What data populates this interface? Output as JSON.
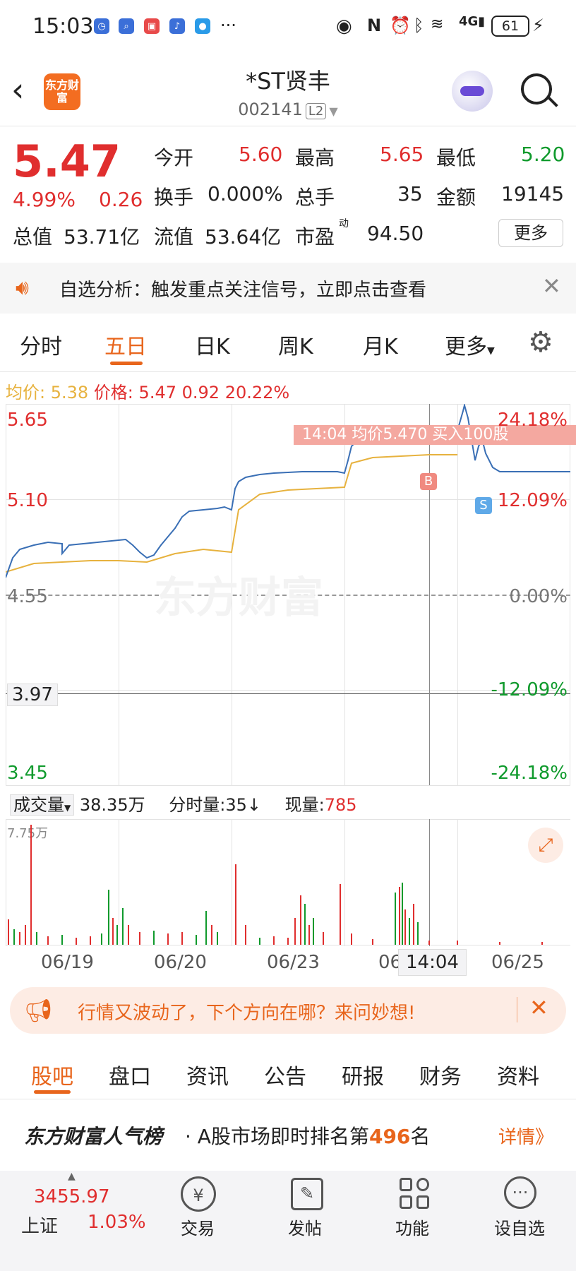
{
  "status_bar": {
    "time": "15:03",
    "more": "···",
    "battery": "61"
  },
  "header": {
    "title": "*ST贤丰",
    "code": "002141",
    "level_badge": "L2",
    "logo_text": "东方财富"
  },
  "quote": {
    "price": "5.47",
    "change_pct": "4.99%",
    "change": "0.26",
    "open_label": "今开",
    "open": "5.60",
    "high_label": "最高",
    "high": "5.65",
    "low_label": "最低",
    "low": "5.20",
    "turnover_label": "换手",
    "turnover": "0.000%",
    "volume_label": "总手",
    "volume": "35",
    "amount_label": "金额",
    "amount": "19145",
    "total_cap_label": "总值",
    "total_cap": "53.71亿",
    "float_cap_label": "流值",
    "float_cap": "53.64亿",
    "pe_label": "市盈",
    "pe_sup": "动",
    "pe": "94.50",
    "more_label": "更多"
  },
  "notify": {
    "text": "自选分析：触发重点关注信号，立即点击查看"
  },
  "tabs": [
    {
      "label": "分时",
      "active": false
    },
    {
      "label": "五日",
      "active": true
    },
    {
      "label": "日K",
      "active": false
    },
    {
      "label": "周K",
      "active": false
    },
    {
      "label": "月K",
      "active": false
    },
    {
      "label": "更多",
      "active": false
    }
  ],
  "info_line": {
    "avg_label": "均价:",
    "avg": "5.38",
    "price_label": "价格:",
    "price": "5.47",
    "change": "0.92",
    "change_pct": "20.22%"
  },
  "chart": {
    "y_left": [
      "5.65",
      "5.10",
      "4.55",
      "3.97",
      "3.45"
    ],
    "y_right": [
      "24.18%",
      "12.09%",
      "0.00%",
      "-12.09%",
      "-24.18%"
    ],
    "tooltip": "14:04  均价5.470  买入100股",
    "marker_buy": "B",
    "marker_sell": "S",
    "watermark": "东方财富",
    "vol_bar_label": "成交量",
    "vol_total": "38.35万",
    "vol_tick_label": "分时量:35↓",
    "vol_now_label": "现量:",
    "vol_now": "785",
    "vol_max": "7.75万",
    "x_labels": [
      "06/19",
      "06/20",
      "06/23",
      "06",
      "06/25"
    ],
    "crosshair_time": "14:04"
  },
  "chart_data": {
    "type": "line",
    "x": [
      "06/19",
      "06/20",
      "06/23",
      "06/24",
      "06/25"
    ],
    "series": [],
    "ylim": [
      3.45,
      5.65
    ],
    "y_ticks": [
      3.45,
      3.97,
      4.55,
      5.1,
      5.65
    ]
  },
  "promo": {
    "text": "行情又波动了，下个方向在哪？来问妙想!"
  },
  "bottom_tabs": [
    "股吧",
    "盘口",
    "资讯",
    "公告",
    "研报",
    "财务",
    "资料"
  ],
  "rank": {
    "brand": "东方财富人气榜",
    "prefix": "· A股市场即时排名第",
    "rank": "496",
    "suffix": "名",
    "detail": "详情》"
  },
  "bottom_nav": {
    "index_value": "3455.97",
    "index_name": "上证",
    "index_change": "1.03%",
    "items": [
      "交易",
      "发帖",
      "功能",
      "设自选"
    ]
  },
  "colors": {
    "up": "#e02e2e",
    "down": "#0f9a2c",
    "accent": "#e8651c",
    "line": "#3a6fb5",
    "avg": "#e7b23e"
  }
}
